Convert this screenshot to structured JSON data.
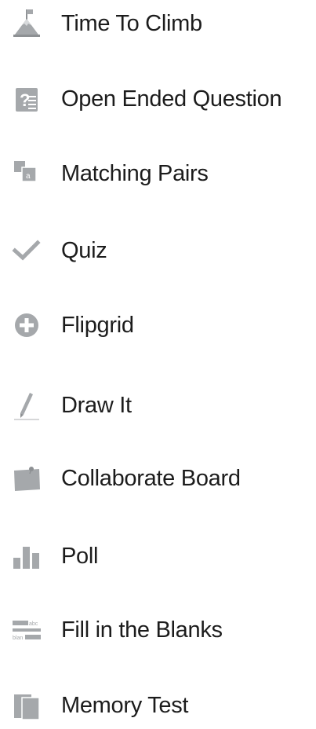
{
  "menu": {
    "items": [
      {
        "label": "Time To Climb",
        "icon": "mountain-flag-icon"
      },
      {
        "label": "Open Ended Question",
        "icon": "question-document-icon"
      },
      {
        "label": "Matching Pairs",
        "icon": "matching-cards-icon"
      },
      {
        "label": "Quiz",
        "icon": "checkmark-icon"
      },
      {
        "label": "Flipgrid",
        "icon": "plus-circle-icon"
      },
      {
        "label": "Draw It",
        "icon": "pencil-icon"
      },
      {
        "label": "Collaborate Board",
        "icon": "pinned-board-icon"
      },
      {
        "label": "Poll",
        "icon": "bar-chart-icon"
      },
      {
        "label": "Fill in the Blanks",
        "icon": "fill-blanks-icon"
      },
      {
        "label": "Memory Test",
        "icon": "memory-cards-icon"
      }
    ]
  },
  "colors": {
    "icon": "#a5a8ab",
    "icon_dark": "#8d9093",
    "text": "#1c1c1c",
    "background": "#ffffff"
  }
}
